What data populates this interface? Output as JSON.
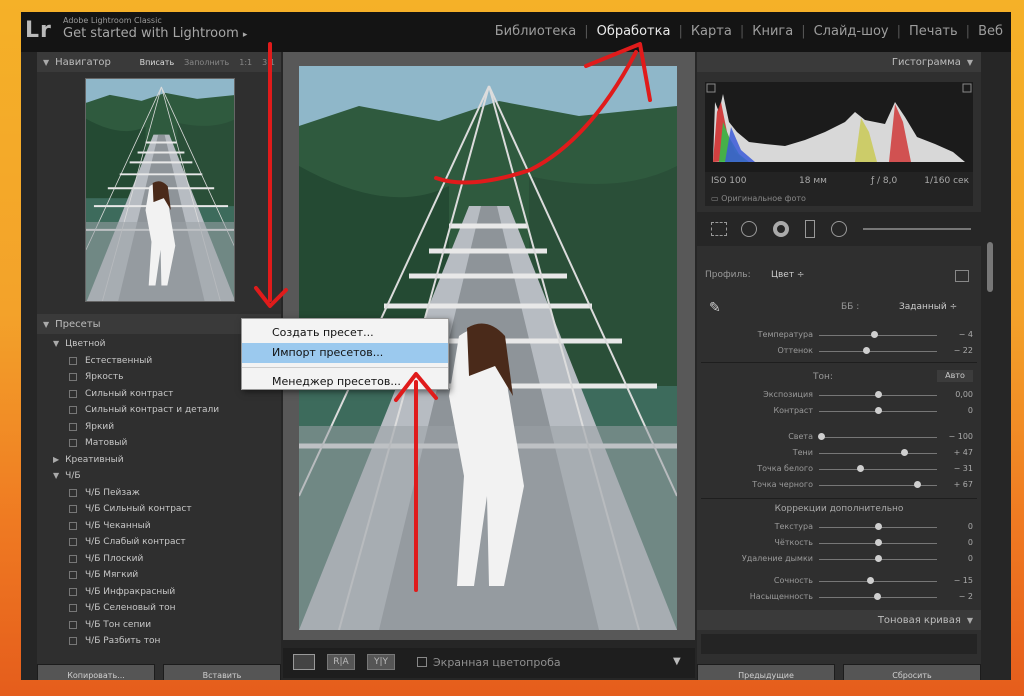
{
  "app": {
    "logo": "Lr",
    "brand_small": "Adobe Lightroom Classic",
    "brand_title": "Get started with Lightroom",
    "brand_arrow": "▸"
  },
  "modules": [
    {
      "label": "Библиотека",
      "active": false
    },
    {
      "label": "Обработка",
      "active": true
    },
    {
      "label": "Карта",
      "active": false
    },
    {
      "label": "Книга",
      "active": false
    },
    {
      "label": "Слайд-шоу",
      "active": false
    },
    {
      "label": "Печать",
      "active": false
    },
    {
      "label": "Веб",
      "active": false
    }
  ],
  "navigator": {
    "title": "Навигатор",
    "options": [
      "Вписать",
      "Заполнить",
      "1:1",
      "3:1"
    ]
  },
  "presets": {
    "title": "Пресеты",
    "add_button": "+.",
    "groups": [
      {
        "name": "Цветной",
        "items": [
          "Естественный",
          "Яркость",
          "Сильный контраст",
          "Сильный контраст и детали",
          "Яркий",
          "Матовый"
        ]
      },
      {
        "name": "Креативный",
        "items": []
      },
      {
        "name": "Ч/Б",
        "items": [
          "Ч/Б Пейзаж",
          "Ч/Б Сильный контраст",
          "Ч/Б Чеканный",
          "Ч/Б Слабый контраст",
          "Ч/Б Плоский",
          "Ч/Б Мягкий",
          "Ч/Б Инфракрасный",
          "Ч/Б Селеновый тон",
          "Ч/Б Тон сепии",
          "Ч/Б Разбить тон"
        ]
      }
    ]
  },
  "context_menu": {
    "items": [
      "Создать пресет...",
      "Импорт пресетов...",
      "Менеджер пресетов..."
    ]
  },
  "left_buttons": {
    "copy": "Копировать...",
    "paste": "Вставить"
  },
  "toolbar": {
    "softproof": "Экранная цветопроба",
    "compare1": "R|A",
    "compare2": "Y|Y"
  },
  "histogram": {
    "title": "Гистограмма",
    "iso": "ISO 100",
    "focal": "18 мм",
    "aperture": "ƒ / 8,0",
    "shutter": "1/160 сек",
    "original": "Оригинальное фото"
  },
  "basic": {
    "profile_label": "Профиль:",
    "profile_value": "Цвет ÷",
    "wb_label": "ББ :",
    "wb_value": "Заданный ÷",
    "tone_label": "Тон:",
    "auto": "Авто",
    "presence_title": "Коррекции дополнительно",
    "sliders": [
      {
        "label": "Температура",
        "value": "− 4",
        "pos": 0.47
      },
      {
        "label": "Оттенок",
        "value": "− 22",
        "pos": 0.4
      },
      {
        "label": "Экспозиция",
        "value": "0,00",
        "pos": 0.5
      },
      {
        "label": "Контраст",
        "value": "0",
        "pos": 0.5
      },
      {
        "label": "Света",
        "value": "− 100",
        "pos": 0.02
      },
      {
        "label": "Тени",
        "value": "+ 47",
        "pos": 0.72
      },
      {
        "label": "Точка белого",
        "value": "− 31",
        "pos": 0.35
      },
      {
        "label": "Точка черного",
        "value": "+ 67",
        "pos": 0.83
      },
      {
        "label": "Текстура",
        "value": "0",
        "pos": 0.5
      },
      {
        "label": "Чёткость",
        "value": "0",
        "pos": 0.5
      },
      {
        "label": "Удаление дымки",
        "value": "0",
        "pos": 0.5
      },
      {
        "label": "Сочность",
        "value": "− 15",
        "pos": 0.43
      },
      {
        "label": "Насыщенность",
        "value": "− 2",
        "pos": 0.49
      }
    ]
  },
  "tone_curve": {
    "title": "Тоновая кривая"
  },
  "right_buttons": {
    "prev": "Предыдущие",
    "reset": "Сбросить"
  },
  "colors": {
    "accent_arrow": "#e01b1b",
    "menu_highlight": "#9bc9ee"
  }
}
